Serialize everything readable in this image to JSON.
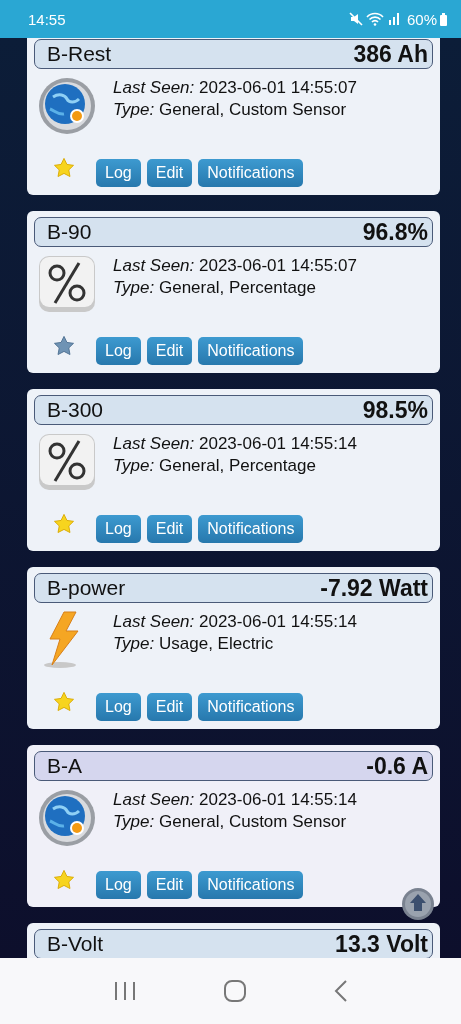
{
  "status_bar": {
    "time": "14:55",
    "battery": "60%"
  },
  "sensors": [
    {
      "name": "B-Rest",
      "value": "386 Ah",
      "last_seen": "*Last Seen:* 2023-06-01 14:55:07",
      "type": "*Type:* General, Custom Sensor",
      "kind": "custom",
      "favorite": true,
      "highlighted": false,
      "buttons": [
        "Log",
        "Edit",
        "Notifications"
      ]
    },
    {
      "name": "B-90",
      "value": "96.8%",
      "last_seen": "*Last Seen:* 2023-06-01 14:55:07",
      "type": "*Type:* General, Percentage",
      "kind": "percentage",
      "favorite": false,
      "highlighted": false,
      "buttons": [
        "Log",
        "Edit",
        "Notifications"
      ]
    },
    {
      "name": "B-300",
      "value": "98.5%",
      "last_seen": "*Last Seen:* 2023-06-01 14:55:14",
      "type": "*Type:* General, Percentage",
      "kind": "percentage",
      "favorite": true,
      "highlighted": false,
      "buttons": [
        "Log",
        "Edit",
        "Notifications"
      ]
    },
    {
      "name": "B-power",
      "value": "-7.92 Watt",
      "last_seen": "*Last Seen:* 2023-06-01 14:55:14",
      "type": "*Type:* Usage, Electric",
      "kind": "electric",
      "favorite": true,
      "highlighted": false,
      "buttons": [
        "Log",
        "Edit",
        "Notifications"
      ]
    },
    {
      "name": "B-A",
      "value": "-0.6 A",
      "last_seen": "*Last Seen:* 2023-06-01 14:55:14",
      "type": "*Type:* General, Custom Sensor",
      "kind": "custom",
      "favorite": true,
      "highlighted": true,
      "buttons": [
        "Log",
        "Edit",
        "Notifications"
      ]
    },
    {
      "name": "B-Volt",
      "value": "13.3 Volt",
      "highlighted": false
    }
  ]
}
